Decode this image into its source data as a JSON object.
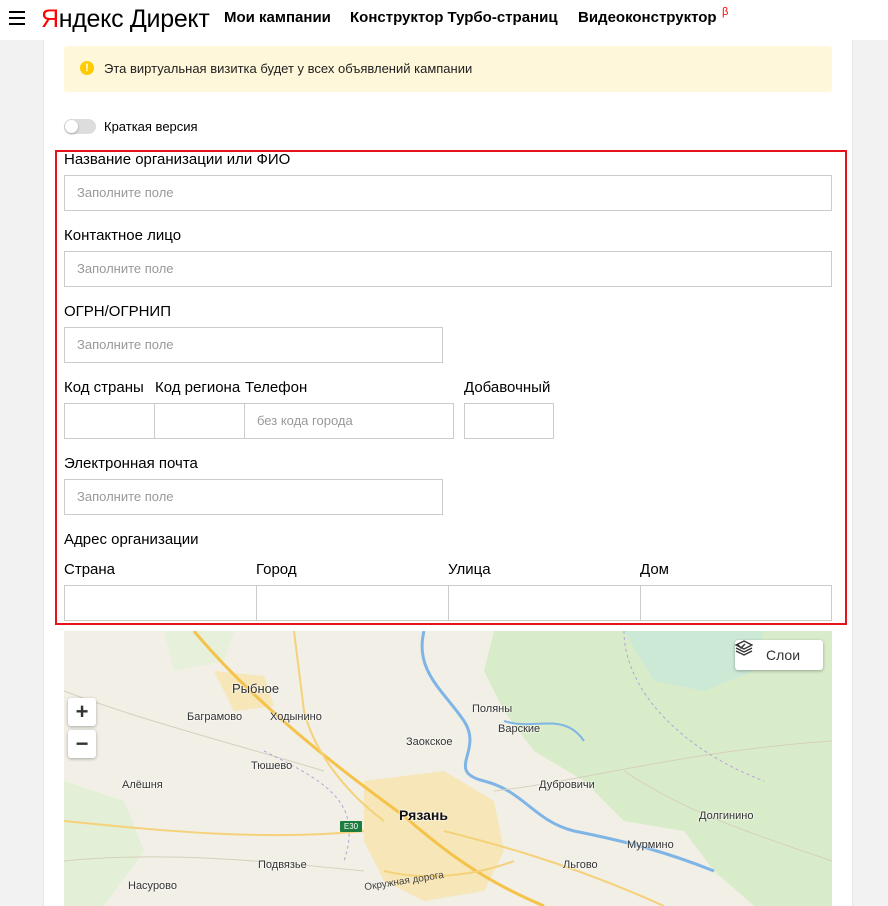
{
  "header": {
    "logo_first": "Я",
    "logo_rest": "ндекс Директ",
    "nav": [
      "Мои кампании",
      "Конструктор Турбо-страниц",
      "Видеоконструктор"
    ],
    "beta": "β"
  },
  "notice": {
    "icon": "!",
    "text": "Эта виртуальная визитка будет у всех объявлений кампании"
  },
  "short_version": {
    "label": "Краткая версия",
    "on": false
  },
  "form": {
    "org_name": {
      "label": "Название организации или ФИО",
      "placeholder": "Заполните поле"
    },
    "contact": {
      "label": "Контактное лицо",
      "placeholder": "Заполните поле"
    },
    "ogrn": {
      "label": "ОГРН/ОГРНИП",
      "placeholder": "Заполните поле"
    },
    "phone": {
      "country_label": "Код страны",
      "region_label": "Код региона",
      "phone_label": "Телефон",
      "phone_placeholder": "без кода города",
      "ext_label": "Добавочный"
    },
    "email": {
      "label": "Электронная почта",
      "placeholder": "Заполните поле"
    },
    "address": {
      "title": "Адрес организации",
      "country": "Страна",
      "city": "Город",
      "street": "Улица",
      "house": "Дом"
    }
  },
  "map": {
    "zoom_in": "+",
    "zoom_out": "−",
    "layers": "Слои",
    "places": {
      "p1": "Рыбное",
      "p2": "Баграмово",
      "p3": "Ходынино",
      "p4": "Поляны",
      "p5": "Варские",
      "p6": "Заокское",
      "p7": "Тюшево",
      "p8": "Алёшня",
      "p9": "Дубровичи",
      "p10": "Рязань",
      "p11": "Долгинино",
      "p12": "Мурмино",
      "p13": "Подвязье",
      "p14": "Насурово",
      "p15": "Льгово"
    },
    "road_label": "Окружная дорога",
    "route_shield": "E30"
  },
  "colors": {
    "highlight": "#e4141a",
    "notice_bg": "#fef7d9",
    "brand_red": "#ff0000"
  }
}
